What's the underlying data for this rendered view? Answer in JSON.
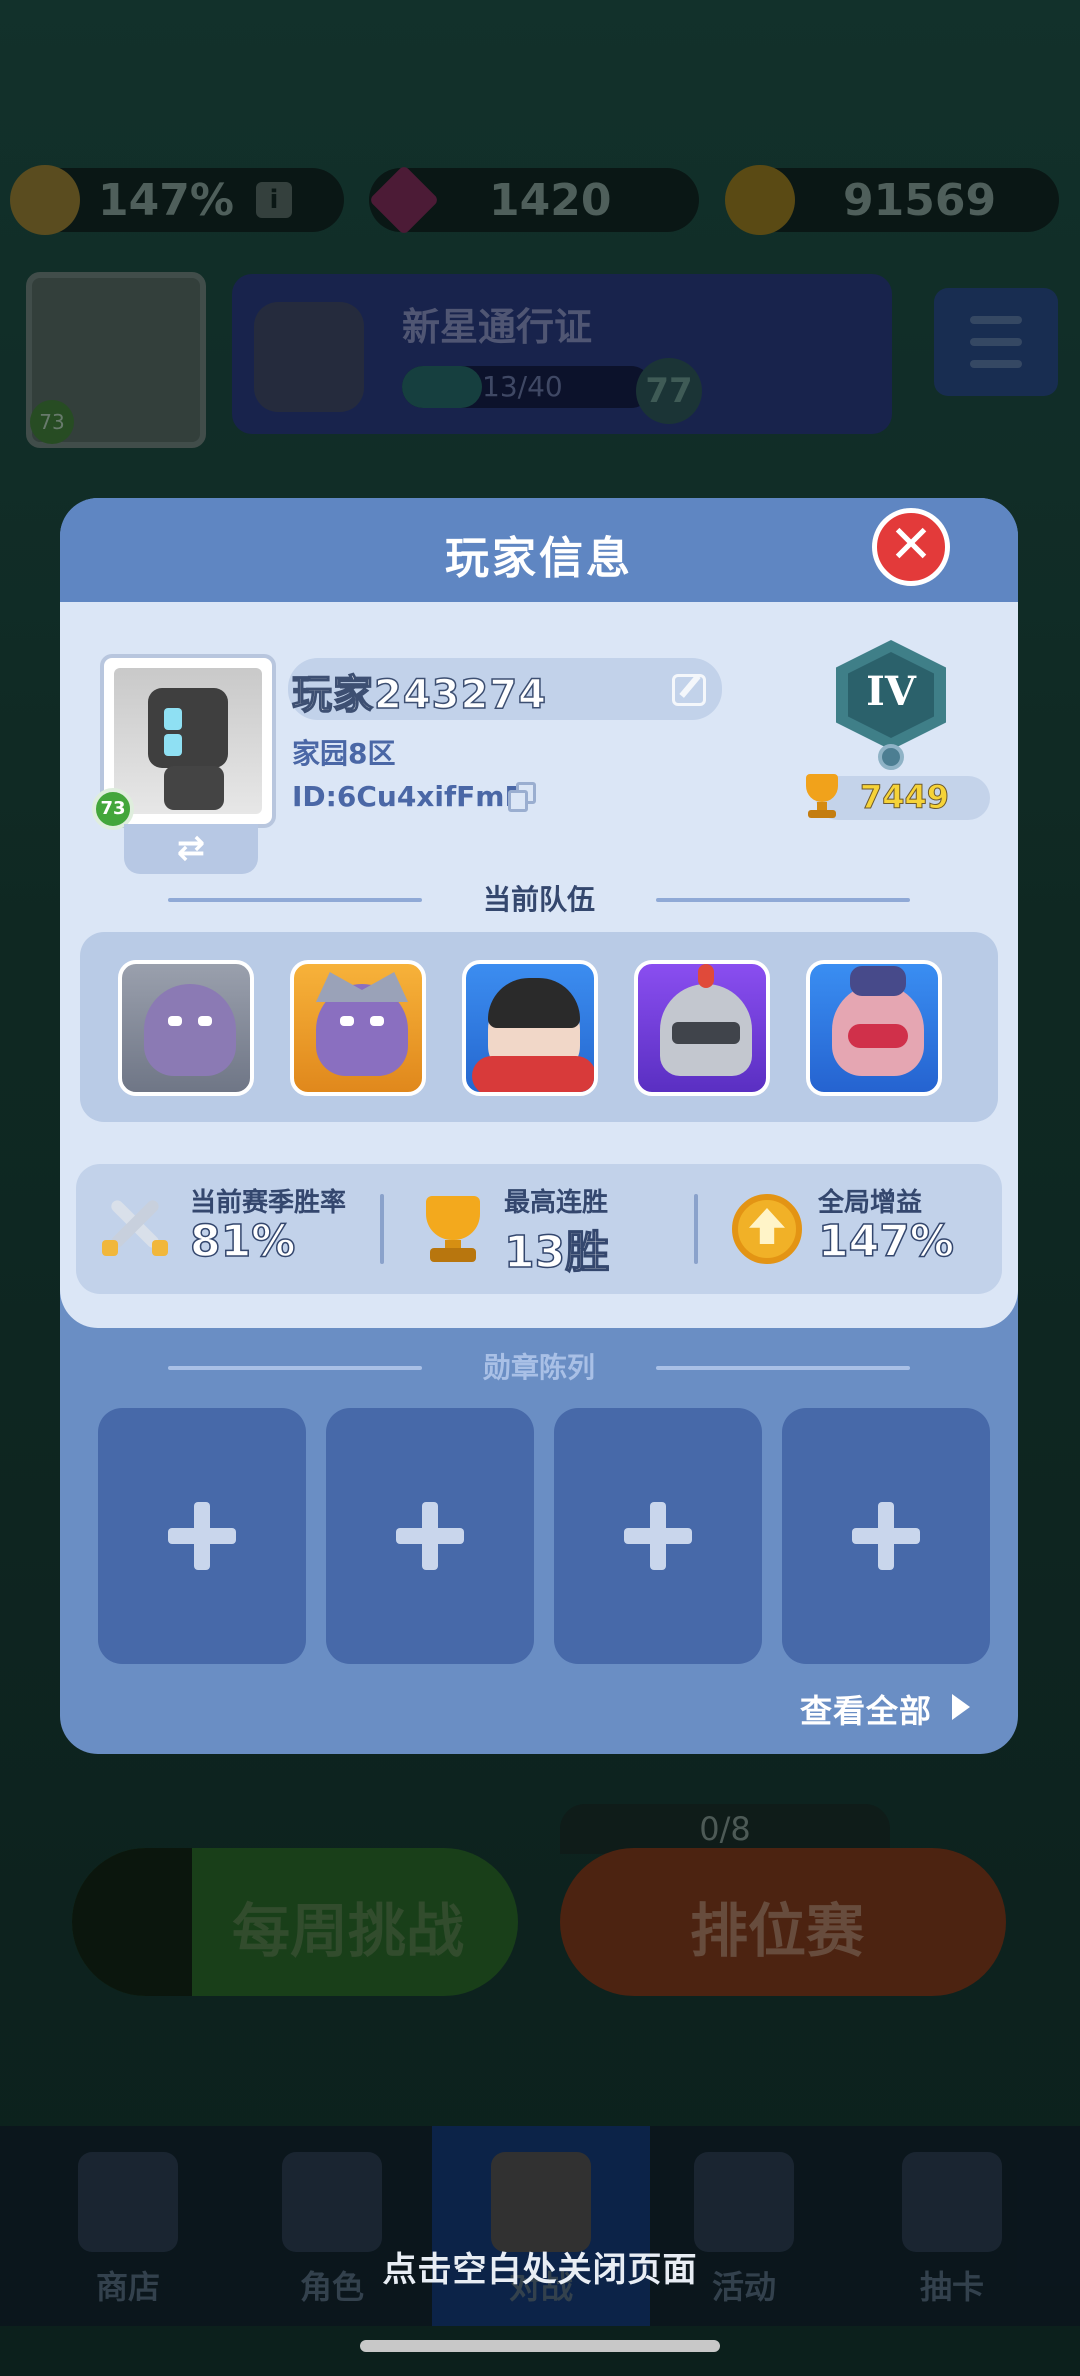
{
  "background": {
    "resources": {
      "boost_value": "147%",
      "boost_info_icon": "info-icon",
      "gems": "1420",
      "coins": "91569"
    },
    "player_level": "73",
    "pass": {
      "title": "新星通行证",
      "progress": "13/40",
      "level": "77"
    },
    "weekly_challenge": "每周挑战",
    "ranked": {
      "label": "排位赛",
      "count": "0/8"
    },
    "nav": [
      {
        "label": "商店",
        "icon": "shop-icon"
      },
      {
        "label": "角色",
        "icon": "characters-icon"
      },
      {
        "label": "对战",
        "icon": "battle-icon"
      },
      {
        "label": "活动",
        "icon": "events-icon"
      },
      {
        "label": "抽卡",
        "icon": "gacha-icon"
      }
    ],
    "close_hint": "点击空白处关闭页面"
  },
  "modal": {
    "title": "玩家信息",
    "close_icon": "close-icon",
    "player": {
      "name": "玩家243274",
      "home": "家园8区",
      "id": "ID:6Cu4xifFmE",
      "level": "73",
      "rank_roman": "IV",
      "trophies": "7449"
    },
    "team": {
      "title": "当前队伍",
      "heroes": [
        "hero-purple-elf",
        "hero-armored-elf",
        "hero-cheer-girl",
        "hero-knight",
        "hero-masked-brawler"
      ]
    },
    "stats": {
      "win_rate_label": "当前赛季胜率",
      "win_rate_value": "81%",
      "streak_label": "最高连胜",
      "streak_value": "13胜",
      "boost_label": "全局增益",
      "boost_value": "147%"
    },
    "medals": {
      "title": "勋章陈列",
      "slots": [
        "+",
        "+",
        "+",
        "+"
      ],
      "view_all": "查看全部"
    }
  },
  "colors": {
    "modal_blue": "#6a8ec4",
    "panel_light": "#dbe6f6",
    "close_red": "#e33a3a",
    "accent_gold": "#f6d338"
  }
}
